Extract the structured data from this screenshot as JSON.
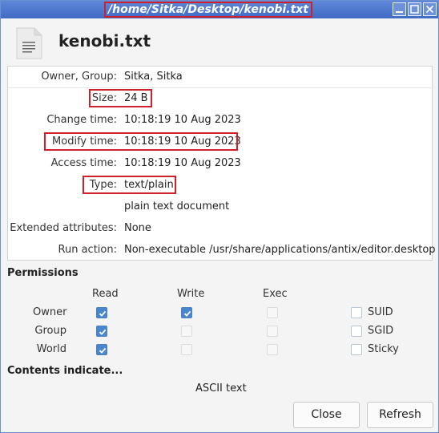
{
  "window": {
    "title": "/home/Sitka/Desktop/kenobi.txt",
    "controls": [
      "minimize-icon",
      "maximize-icon",
      "close-icon"
    ]
  },
  "file": {
    "name": "kenobi.txt",
    "icon": "text-file-icon"
  },
  "info": {
    "owner_group": {
      "label": "Owner, Group:",
      "value": "Sitka, Sitka"
    },
    "size": {
      "label": "Size:",
      "value": "24 B"
    },
    "change_time": {
      "label": "Change time:",
      "value": "10:18:19 10 Aug 2023"
    },
    "modify_time": {
      "label": "Modify time:",
      "value": "10:18:19 10 Aug 2023"
    },
    "access_time": {
      "label": "Access time:",
      "value": "10:18:19 10 Aug 2023"
    },
    "type": {
      "label": "Type:",
      "value": "text/plain",
      "description": "plain text document"
    },
    "extended_attributes": {
      "label": "Extended attributes:",
      "value": "None"
    },
    "run_action": {
      "label": "Run action:",
      "value": "Non-executable /usr/share/applications/antix/editor.desktop"
    }
  },
  "permissions": {
    "title": "Permissions",
    "columns": {
      "read": "Read",
      "write": "Write",
      "exec": "Exec"
    },
    "rows": {
      "owner": {
        "label": "Owner",
        "read": true,
        "write": true,
        "exec": false,
        "special_label": "SUID",
        "special": false
      },
      "group": {
        "label": "Group",
        "read": true,
        "write": false,
        "exec": false,
        "special_label": "SGID",
        "special": false
      },
      "world": {
        "label": "World",
        "read": true,
        "write": false,
        "exec": false,
        "special_label": "Sticky",
        "special": false
      }
    }
  },
  "contents": {
    "title": "Contents indicate...",
    "value": "ASCII text"
  },
  "buttons": {
    "close": "Close",
    "refresh": "Refresh"
  },
  "colors": {
    "titlebar": "#4a76cc",
    "highlight": "#d0212a",
    "checkbox_on": "#4a86cc"
  }
}
